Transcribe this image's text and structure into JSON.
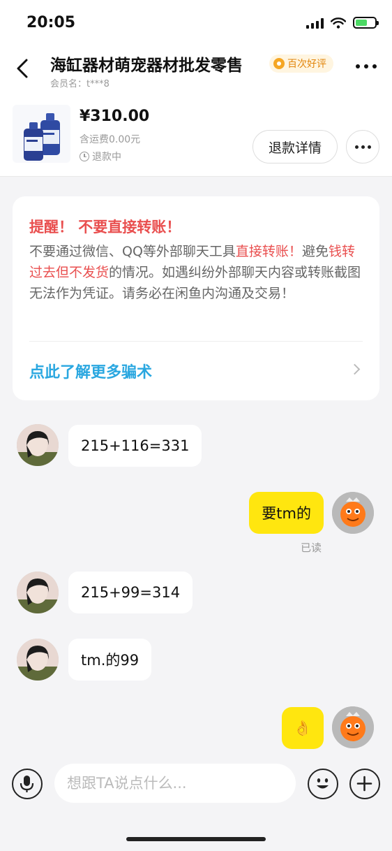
{
  "status_bar": {
    "time": "20:05"
  },
  "header": {
    "title": "海缸器材萌宠器材批发零售",
    "badge": "百次好评",
    "member_label": "会员名：t***8"
  },
  "product": {
    "price": "¥310.00",
    "shipping": "含运费0.00元",
    "status": "退款中",
    "refund_button": "退款详情"
  },
  "warning": {
    "title": "提醒！ 不要直接转账！",
    "body_part1": "不要通过微信、QQ等外部聊天工具",
    "body_red1": "直接转账！",
    "body_part2": "避免",
    "body_red2": "钱转过去但不发货",
    "body_part3": "的情况。如遇纠纷外部聊天内容或转账截图无法作为凭证。请务必在闲鱼内沟通及交易！",
    "link": "点此了解更多骗术"
  },
  "messages": [
    {
      "side": "left",
      "text": "215+116=331"
    },
    {
      "side": "right",
      "text": "要tm的",
      "read": "已读"
    },
    {
      "side": "left",
      "text": "215+99=314"
    },
    {
      "side": "left",
      "text": "tm.的99"
    },
    {
      "side": "right",
      "text": "👌"
    }
  ],
  "composer": {
    "placeholder": "想跟TA说点什么..."
  },
  "icons": {
    "back": "chevron-left-icon",
    "more": "more-dots-icon",
    "voice": "microphone-icon",
    "emoji": "emoji-icon",
    "add": "plus-icon",
    "clock": "clock-icon"
  },
  "colors": {
    "accent_yellow": "#ffe60f",
    "warning_red": "#e94f4f",
    "link_blue": "#2aa7e0",
    "badge_orange": "#e2850b"
  }
}
